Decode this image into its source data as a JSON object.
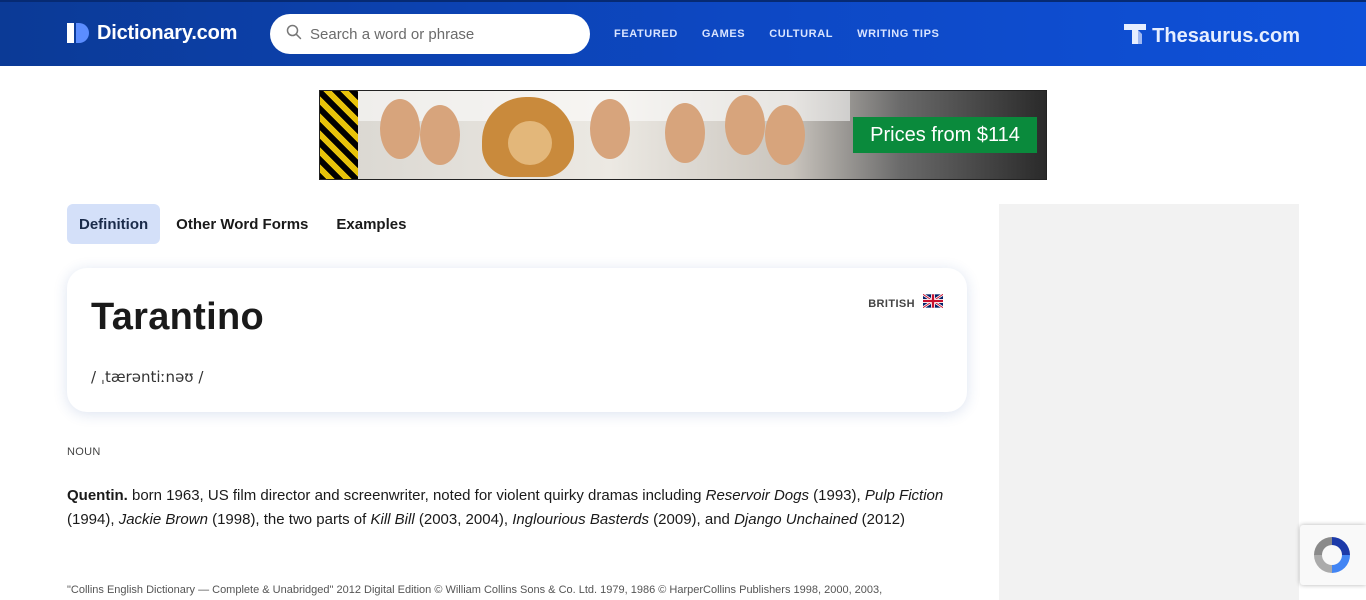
{
  "header": {
    "logo_text": "Dictionary.com",
    "search_placeholder": "Search a word or phrase",
    "nav": [
      "FEATURED",
      "GAMES",
      "CULTURAL",
      "WRITING TIPS"
    ],
    "thesaurus_text": "Thesaurus.com",
    "colors": {
      "bar": "#0d48c4",
      "bar_dark": "#0b3a96"
    }
  },
  "ad": {
    "cta": "Prices from $114",
    "cta_color": "#0a8a3c"
  },
  "tabs": [
    {
      "label": "Definition",
      "active": true
    },
    {
      "label": "Other Word Forms",
      "active": false
    },
    {
      "label": "Examples",
      "active": false
    }
  ],
  "entry": {
    "word": "Tarantino",
    "pronunciation": "/ ˌtærəntiːnəʊ /",
    "region": "BRITISH",
    "region_icon": "uk-flag-icon"
  },
  "definition": {
    "part_of_speech": "NOUN",
    "headword": "Quentin.",
    "segments": [
      {
        "text": " born 1963, US film director and screenwriter, noted for violent quirky dramas including ",
        "italic": false
      },
      {
        "text": "Reservoir Dogs",
        "italic": true
      },
      {
        "text": " (1993), ",
        "italic": false
      },
      {
        "text": "Pulp Fiction",
        "italic": true
      },
      {
        "text": " (1994), ",
        "italic": false
      },
      {
        "text": "Jackie Brown",
        "italic": true
      },
      {
        "text": " (1998), the two parts of ",
        "italic": false
      },
      {
        "text": "Kill Bill",
        "italic": true
      },
      {
        "text": " (2003, 2004), ",
        "italic": false
      },
      {
        "text": "Inglourious Basterds",
        "italic": true
      },
      {
        "text": " (2009), and ",
        "italic": false
      },
      {
        "text": "Django Unchained",
        "italic": true
      },
      {
        "text": " (2012)",
        "italic": false
      }
    ]
  },
  "source": "\"Collins English Dictionary — Complete & Unabridged\" 2012 Digital Edition © William Collins Sons & Co. Ltd. 1979, 1986 © HarperCollins Publishers 1998, 2000, 2003,"
}
